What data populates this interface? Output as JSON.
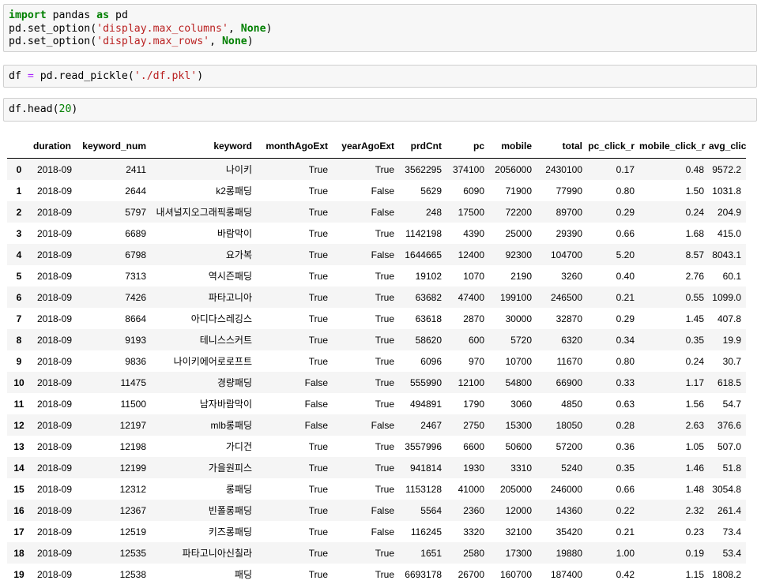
{
  "cells": [
    {
      "lines": [
        [
          [
            "kw",
            "import"
          ],
          [
            "p",
            " pandas "
          ],
          [
            "kw",
            "as"
          ],
          [
            "p",
            " pd"
          ]
        ],
        [
          [
            "p",
            "pd.set_option("
          ],
          [
            "str",
            "'display.max_columns'"
          ],
          [
            "p",
            ", "
          ],
          [
            "kw",
            "None"
          ],
          [
            "p",
            ")"
          ]
        ],
        [
          [
            "p",
            "pd.set_option("
          ],
          [
            "str",
            "'display.max_rows'"
          ],
          [
            "p",
            ", "
          ],
          [
            "kw",
            "None"
          ],
          [
            "p",
            ")"
          ]
        ]
      ]
    },
    {
      "lines": [
        [
          [
            "p",
            "df "
          ],
          [
            "op",
            "="
          ],
          [
            "p",
            " pd.read_pickle("
          ],
          [
            "str",
            "'./df.pkl'"
          ],
          [
            "p",
            ")"
          ]
        ]
      ]
    },
    {
      "lines": [
        [
          [
            "p",
            "df.head("
          ],
          [
            "num",
            "20"
          ],
          [
            "p",
            ")"
          ]
        ]
      ]
    }
  ],
  "table": {
    "columns": [
      "duration",
      "keyword_num",
      "keyword",
      "monthAgoExt",
      "yearAgoExt",
      "prdCnt",
      "pc",
      "mobile",
      "total",
      "pc_click_r",
      "mobile_click_r",
      "avg_click"
    ],
    "rows": [
      [
        "0",
        "2018-09",
        "2411",
        "나이키",
        "True",
        "True",
        "3562295",
        "374100",
        "2056000",
        "2430100",
        "0.17",
        "0.48",
        "9572.2"
      ],
      [
        "1",
        "2018-09",
        "2644",
        "k2롱패딩",
        "True",
        "False",
        "5629",
        "6090",
        "71900",
        "77990",
        "0.80",
        "1.50",
        "1031.8"
      ],
      [
        "2",
        "2018-09",
        "5797",
        "내셔널지오그래픽롱패딩",
        "True",
        "False",
        "248",
        "17500",
        "72200",
        "89700",
        "0.29",
        "0.24",
        "204.9"
      ],
      [
        "3",
        "2018-09",
        "6689",
        "바람막이",
        "True",
        "True",
        "1142198",
        "4390",
        "25000",
        "29390",
        "0.66",
        "1.68",
        "415.0"
      ],
      [
        "4",
        "2018-09",
        "6798",
        "요가복",
        "True",
        "False",
        "1644665",
        "12400",
        "92300",
        "104700",
        "5.20",
        "8.57",
        "8043.1"
      ],
      [
        "5",
        "2018-09",
        "7313",
        "역시즌패딩",
        "True",
        "True",
        "19102",
        "1070",
        "2190",
        "3260",
        "0.40",
        "2.76",
        "60.1"
      ],
      [
        "6",
        "2018-09",
        "7426",
        "파타고니아",
        "True",
        "True",
        "63682",
        "47400",
        "199100",
        "246500",
        "0.21",
        "0.55",
        "1099.0"
      ],
      [
        "7",
        "2018-09",
        "8664",
        "아디다스레깅스",
        "True",
        "True",
        "63618",
        "2870",
        "30000",
        "32870",
        "0.29",
        "1.45",
        "407.8"
      ],
      [
        "8",
        "2018-09",
        "9193",
        "테니스스커트",
        "True",
        "True",
        "58620",
        "600",
        "5720",
        "6320",
        "0.34",
        "0.35",
        "19.9"
      ],
      [
        "9",
        "2018-09",
        "9836",
        "나이키에어로로프트",
        "True",
        "True",
        "6096",
        "970",
        "10700",
        "11670",
        "0.80",
        "0.24",
        "30.7"
      ],
      [
        "10",
        "2018-09",
        "11475",
        "경량패딩",
        "False",
        "True",
        "555990",
        "12100",
        "54800",
        "66900",
        "0.33",
        "1.17",
        "618.5"
      ],
      [
        "11",
        "2018-09",
        "11500",
        "남자바람막이",
        "False",
        "True",
        "494891",
        "1790",
        "3060",
        "4850",
        "0.63",
        "1.56",
        "54.7"
      ],
      [
        "12",
        "2018-09",
        "12197",
        "mlb롱패딩",
        "False",
        "False",
        "2467",
        "2750",
        "15300",
        "18050",
        "0.28",
        "2.63",
        "376.6"
      ],
      [
        "13",
        "2018-09",
        "12198",
        "가디건",
        "True",
        "True",
        "3557996",
        "6600",
        "50600",
        "57200",
        "0.36",
        "1.05",
        "507.0"
      ],
      [
        "14",
        "2018-09",
        "12199",
        "가을원피스",
        "True",
        "True",
        "941814",
        "1930",
        "3310",
        "5240",
        "0.35",
        "1.46",
        "51.8"
      ],
      [
        "15",
        "2018-09",
        "12312",
        "롱패딩",
        "True",
        "True",
        "1153128",
        "41000",
        "205000",
        "246000",
        "0.66",
        "1.48",
        "3054.8"
      ],
      [
        "16",
        "2018-09",
        "12367",
        "빈폴롱패딩",
        "True",
        "False",
        "5564",
        "2360",
        "12000",
        "14360",
        "0.22",
        "2.32",
        "261.4"
      ],
      [
        "17",
        "2018-09",
        "12519",
        "키즈롱패딩",
        "True",
        "False",
        "116245",
        "3320",
        "32100",
        "35420",
        "0.21",
        "0.23",
        "73.4"
      ],
      [
        "18",
        "2018-09",
        "12535",
        "파타고니아신칠라",
        "True",
        "True",
        "1651",
        "2580",
        "17300",
        "19880",
        "1.00",
        "0.19",
        "53.4"
      ],
      [
        "19",
        "2018-09",
        "12538",
        "패딩",
        "True",
        "True",
        "6693178",
        "26700",
        "160700",
        "187400",
        "0.42",
        "1.15",
        "1808.2"
      ]
    ]
  }
}
